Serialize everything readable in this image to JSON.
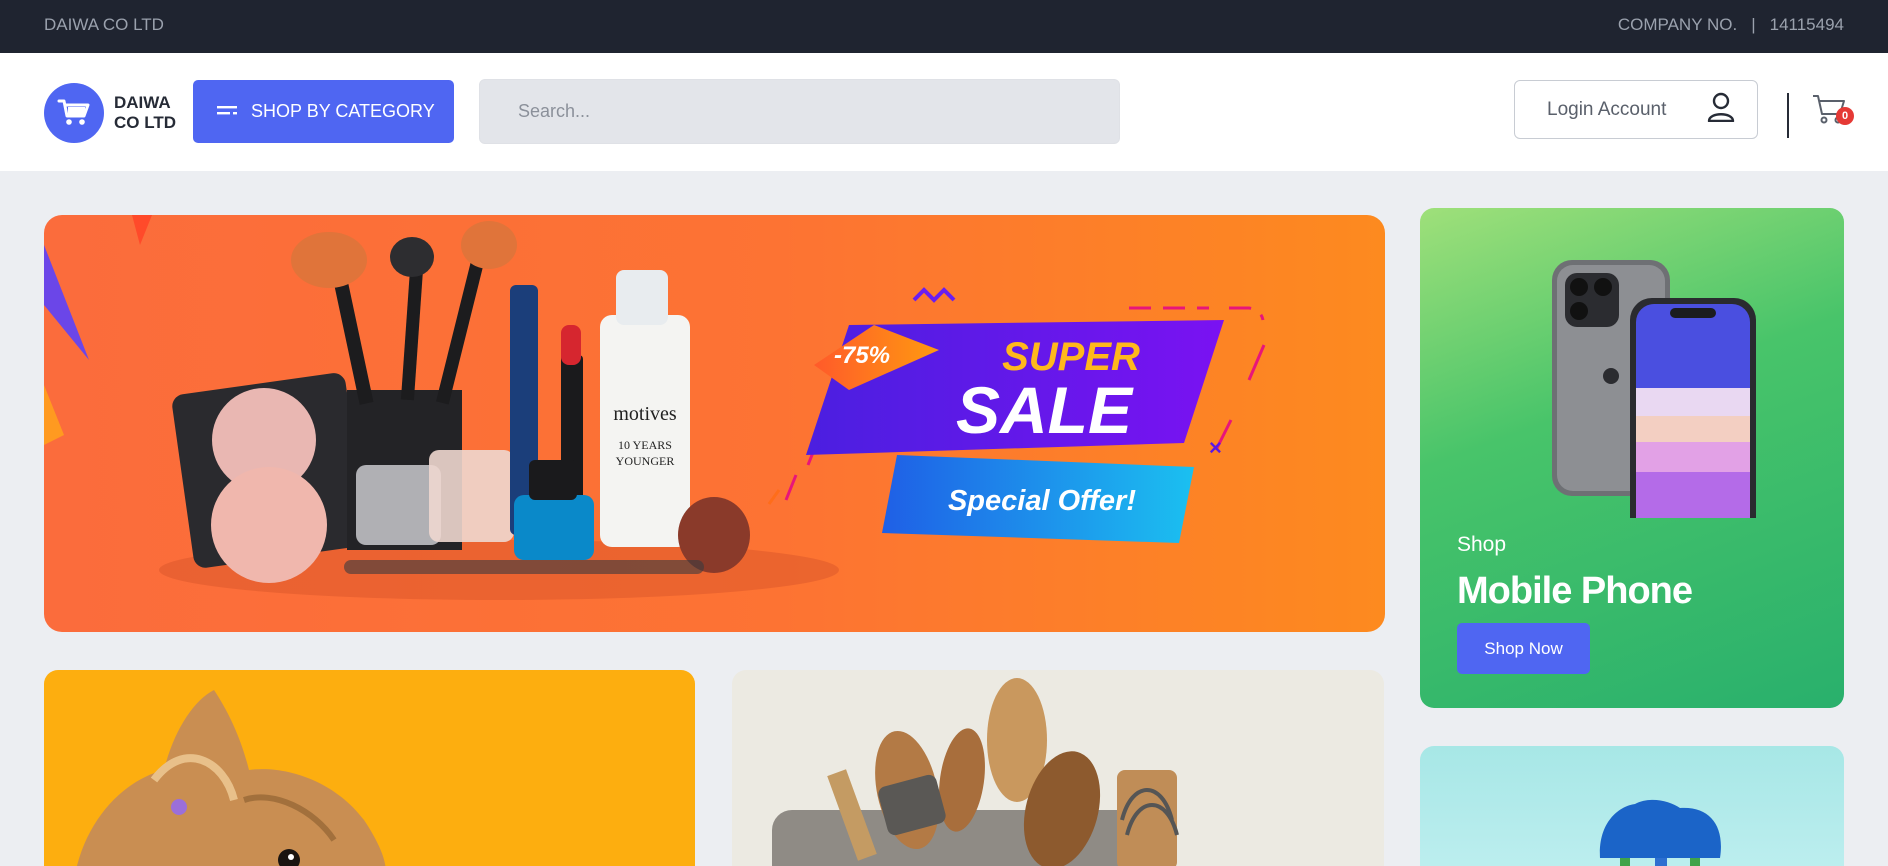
{
  "topbar": {
    "company_name": "DAIWA CO LTD",
    "company_no_label": "COMPANY NO.",
    "separator": "|",
    "company_no": "14115494"
  },
  "header": {
    "logo_text": "DAIWA CO LTD",
    "shop_by_category": "SHOP BY CATEGORY",
    "search_placeholder": "Search...",
    "login_label": "Login Account",
    "cart_count": "0"
  },
  "hero": {
    "discount": "-75%",
    "headline_top": "SUPER",
    "headline_main": "SALE",
    "offer": "Special Offer!",
    "brand": "motives",
    "product_line1": "10 YEARS",
    "product_line2": "YOUNGER"
  },
  "promo_phone": {
    "kicker": "Shop",
    "title": "Mobile Phone",
    "button": "Shop Now"
  },
  "colors": {
    "accent": "#4f66f2",
    "topbar_bg": "#1f2430",
    "hero_orange": "#fd7333",
    "phone_green": "#3fbd6a",
    "dog_yellow": "#fdae0f",
    "badge_red": "#e53935"
  }
}
